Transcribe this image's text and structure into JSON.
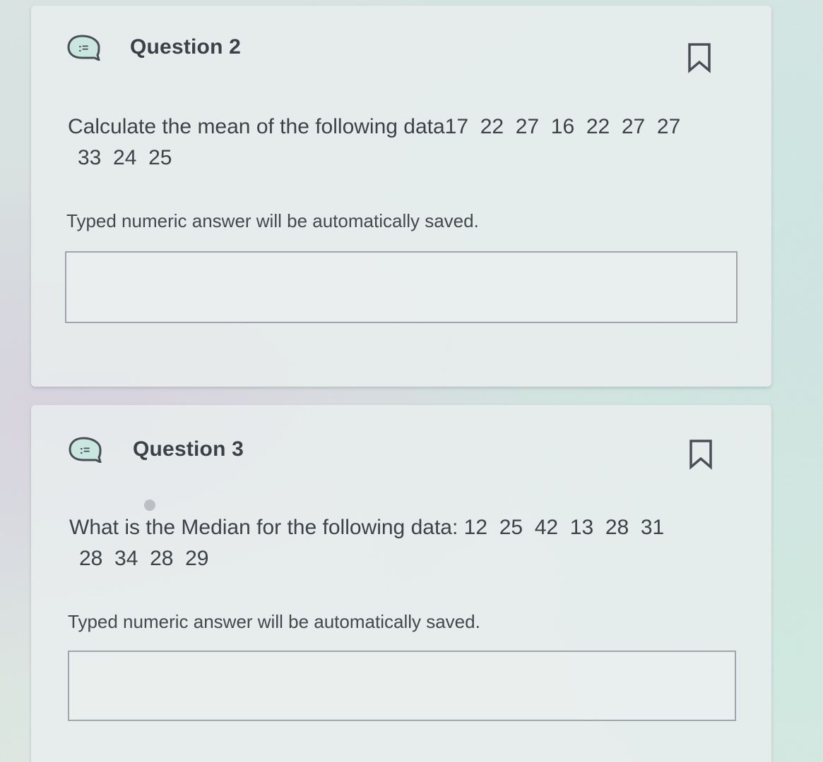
{
  "questions": [
    {
      "title": "Question 2",
      "prompt": "Calculate the mean of the following data",
      "data_line1": "17  22  27  16  22  27  27",
      "data_line2": "33  24  25",
      "hint": "Typed numeric answer will be automatically saved.",
      "answer_value": ""
    },
    {
      "title": "Question 3",
      "prompt": "What is the Median for the following data:",
      "data_line1": "12  25  42  13  28  31",
      "data_line2": "28  34  28  29",
      "hint": "Typed numeric answer will be automatically saved.",
      "answer_value": ""
    }
  ],
  "icons": {
    "question_type": "question-list-icon",
    "bookmark": "bookmark-icon"
  },
  "colors": {
    "text": "#3b4148",
    "icon_stroke": "#4a4f57",
    "icon_fill": "#c9e6df",
    "border": "#9ea6ab"
  }
}
